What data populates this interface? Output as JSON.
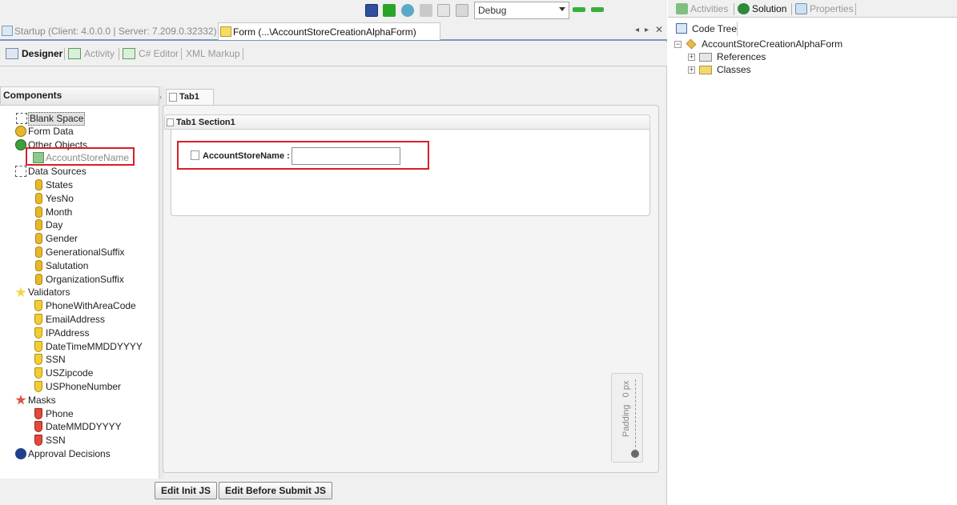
{
  "toolbar": {
    "config_select": "Debug",
    "icons": [
      "save-icon",
      "validate-icon",
      "run-icon",
      "stop-icon",
      "copy-icon",
      "paste-icon",
      "back-arrow-icon",
      "forward-arrow-icon"
    ]
  },
  "doc_tabs": [
    {
      "label": "Startup (Client: 4.0.0.0 | Server: 7.209.0.32332)",
      "active": false
    },
    {
      "label": "Form (...\\AccountStoreCreationAlphaForm)",
      "active": true
    }
  ],
  "design_tabs": [
    {
      "label": "Designer",
      "active": true
    },
    {
      "label": "Activity",
      "active": false
    },
    {
      "label": "C# Editor",
      "active": false
    },
    {
      "label": "XML Markup",
      "active": false
    }
  ],
  "components": {
    "header": "Components",
    "items": [
      {
        "label": "Blank Space",
        "level": 0,
        "icon": "blank-space-icon"
      },
      {
        "label": "Form Data",
        "level": 0,
        "icon": "form-data-icon"
      },
      {
        "label": "Other Objects",
        "level": 0,
        "icon": "other-objects-icon"
      },
      {
        "label": "AccountStoreName",
        "level": 1,
        "icon": "cube-icon"
      },
      {
        "label": "Data Sources",
        "level": 0,
        "icon": "data-sources-icon"
      },
      {
        "label": "States",
        "level": 1,
        "icon": "database-icon"
      },
      {
        "label": "YesNo",
        "level": 1,
        "icon": "database-icon"
      },
      {
        "label": "Month",
        "level": 1,
        "icon": "database-icon"
      },
      {
        "label": "Day",
        "level": 1,
        "icon": "database-icon"
      },
      {
        "label": "Gender",
        "level": 1,
        "icon": "database-icon"
      },
      {
        "label": "GenerationalSuffix",
        "level": 1,
        "icon": "database-icon"
      },
      {
        "label": "Salutation",
        "level": 1,
        "icon": "database-icon"
      },
      {
        "label": "OrganizationSuffix",
        "level": 1,
        "icon": "database-icon"
      },
      {
        "label": "Validators",
        "level": 0,
        "icon": "star-icon"
      },
      {
        "label": "PhoneWithAreaCode",
        "level": 1,
        "icon": "validator-shield-icon"
      },
      {
        "label": "EmailAddress",
        "level": 1,
        "icon": "validator-shield-icon"
      },
      {
        "label": "IPAddress",
        "level": 1,
        "icon": "validator-shield-icon"
      },
      {
        "label": "DateTimeMMDDYYYY",
        "level": 1,
        "icon": "validator-shield-icon"
      },
      {
        "label": "SSN",
        "level": 1,
        "icon": "validator-shield-icon"
      },
      {
        "label": "USZipcode",
        "level": 1,
        "icon": "validator-shield-icon"
      },
      {
        "label": "USPhoneNumber",
        "level": 1,
        "icon": "validator-shield-icon"
      },
      {
        "label": "Masks",
        "level": 0,
        "icon": "masks-star-icon"
      },
      {
        "label": "Phone",
        "level": 1,
        "icon": "mask-shield-icon"
      },
      {
        "label": "DateMMDDYYYY",
        "level": 1,
        "icon": "mask-shield-icon"
      },
      {
        "label": "SSN",
        "level": 1,
        "icon": "mask-shield-icon"
      },
      {
        "label": "Approval Decisions",
        "level": 0,
        "icon": "help-circle-icon"
      }
    ]
  },
  "designer": {
    "tab_label": "Tab1",
    "section_title": "Tab1 Section1",
    "field_label": "AccountStoreName :",
    "field_value": "",
    "padding_label": "Padding",
    "padding_value": "0 px"
  },
  "buttons": {
    "edit_init": "Edit Init JS",
    "edit_before_submit": "Edit Before Submit JS"
  },
  "right_panel": {
    "tabs": [
      {
        "label": "Activities",
        "active": false
      },
      {
        "label": "Solution",
        "active": true
      },
      {
        "label": "Properties",
        "active": false
      }
    ],
    "subtab": "Code Tree",
    "tree": {
      "root": "AccountStoreCreationAlphaForm",
      "children": [
        "References",
        "Classes"
      ]
    }
  },
  "colors": {
    "highlight": "#d81e2a",
    "tab_underline": "#7a96c0"
  }
}
